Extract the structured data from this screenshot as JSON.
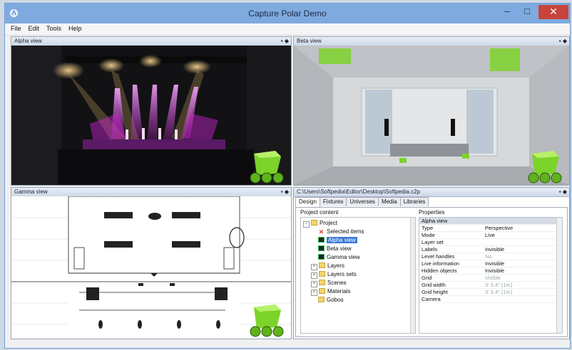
{
  "window": {
    "title": "Capture Polar Demo",
    "minimize": "–",
    "maximize": "□",
    "close": "✕"
  },
  "menu": [
    "File",
    "Edit",
    "Tools",
    "Help"
  ],
  "views": {
    "alpha": {
      "title": "Alpha view"
    },
    "beta": {
      "title": "Beta view"
    },
    "gamma": {
      "title": "Gamma view"
    },
    "pin_glyphs": "▪ ◆"
  },
  "properties_pane": {
    "title": "C:\\Users\\Softpedia\\Editor\\Desktop\\Softpedia.c2p",
    "tabs": [
      "Design",
      "Fixtures",
      "Universes",
      "Media",
      "Libraries"
    ],
    "project_content_label": "Project content",
    "properties_label": "Properties",
    "tree": [
      {
        "label": "Project",
        "icon": "folder-icon",
        "level": 0,
        "expander": "−"
      },
      {
        "label": "Selected items",
        "icon": "selection-icon",
        "level": 1
      },
      {
        "label": "Alpha view",
        "icon": "view-icon",
        "level": 1,
        "selected": true
      },
      {
        "label": "Beta view",
        "icon": "view-icon",
        "level": 1
      },
      {
        "label": "Gamma view",
        "icon": "view-icon",
        "level": 1
      },
      {
        "label": "Layers",
        "icon": "folder-icon",
        "level": 1,
        "expander": "+"
      },
      {
        "label": "Layers sets",
        "icon": "folder-icon",
        "level": 1,
        "expander": "+"
      },
      {
        "label": "Scenes",
        "icon": "folder-icon",
        "level": 1,
        "expander": "+"
      },
      {
        "label": "Materials",
        "icon": "folder-icon",
        "level": 1,
        "expander": "+"
      },
      {
        "label": "Gobos",
        "icon": "folder-icon",
        "level": 1
      }
    ],
    "properties": [
      {
        "name": "Alpha view",
        "value": "",
        "header": true
      },
      {
        "name": "Type",
        "value": "Perspective"
      },
      {
        "name": "Mode",
        "value": "Live"
      },
      {
        "name": "Layer set",
        "value": ""
      },
      {
        "name": "Labels",
        "value": "Invisible"
      },
      {
        "name": "Level handles",
        "value": "No",
        "dim": true
      },
      {
        "name": "Live information",
        "value": "Invisible"
      },
      {
        "name": "Hidden objects",
        "value": "Invisible"
      },
      {
        "name": "Grid",
        "value": "Visible",
        "dim": true
      },
      {
        "name": "Grid width",
        "value": "3' 3.4\" (1m)",
        "dim": true
      },
      {
        "name": "Grid height",
        "value": "3' 3.4\" (1m)",
        "dim": true
      },
      {
        "name": "Camera",
        "value": ""
      }
    ]
  },
  "colors": {
    "titlebar": "#7eaadf",
    "accent_green": "#7cd32a",
    "stage_magenta": "#d024d8",
    "selection": "#3a78d8"
  }
}
